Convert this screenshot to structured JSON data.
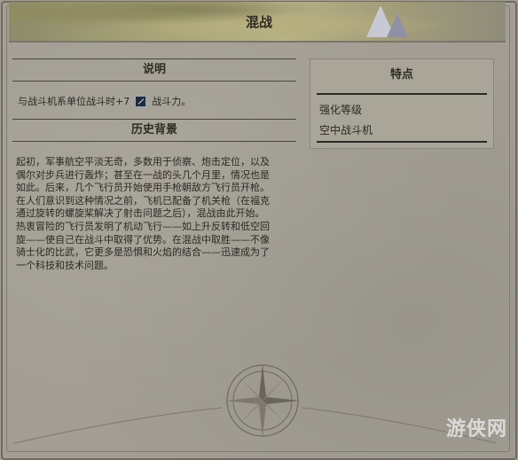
{
  "window": {
    "title": "混战"
  },
  "description": {
    "heading": "说明",
    "text_before": "与战斗机系单位战斗时+7",
    "icon": "sword-icon",
    "text_after": "战斗力。"
  },
  "history": {
    "heading": "历史背景",
    "lines": [
      "起初，军事航空平淡无奇，多数用于侦察、炮击定位，以及",
      "偶尔对步兵进行轰炸；甚至在一战的头几个月里，情况也是",
      "如此。后来，几个飞行员开始使用手枪朝敌方飞行员开枪。",
      "在人们意识到这种情况之前，飞机已配备了机关枪（在福克",
      "通过旋转的螺旋桨解决了射击问题之后），混战由此开始。",
      "热衷冒险的飞行员发明了机动飞行——如上升反转和低空回",
      "旋——使自己在战斗中取得了优势。在混战中取胜——不像",
      "骑士化的比武，它更多是恐惧和火焰的结合——迅速成为了",
      "一个科技和技术问题。"
    ]
  },
  "features": {
    "heading": "特点",
    "items": [
      "强化等级",
      "空中战斗机"
    ]
  },
  "watermark": "游侠网"
}
